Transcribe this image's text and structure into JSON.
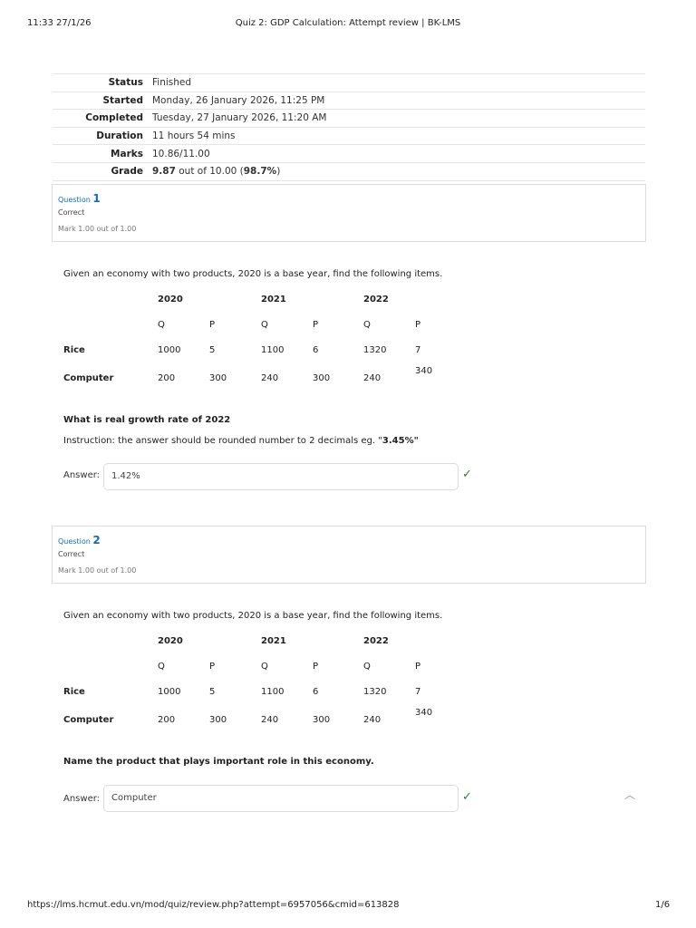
{
  "header": {
    "datetime": "11:33 27/1/26",
    "title": "Quiz 2: GDP Calculation: Attempt review | BK-LMS"
  },
  "summary": [
    {
      "k": "Status",
      "v": "Finished"
    },
    {
      "k": "Started",
      "v": "Monday, 26 January 2026, 11:25 PM"
    },
    {
      "k": "Completed",
      "v": "Tuesday, 27 January 2026, 11:20 AM"
    },
    {
      "k": "Duration",
      "v": "11 hours 54 mins"
    },
    {
      "k": "Marks",
      "v": "10.86/11.00"
    },
    {
      "k": "Grade",
      "v_bold": "9.87",
      "v_mid": " out of 10.00 (",
      "v_pct": "98.7%",
      "v_end": ")"
    }
  ],
  "table": {
    "years": [
      "2020",
      "2021",
      "2022"
    ],
    "q": "Q",
    "p": "P",
    "rows": [
      {
        "name": "Rice",
        "vals": [
          "1000",
          "5",
          "1100",
          "6",
          "1320",
          "7"
        ]
      },
      {
        "name": "Computer",
        "vals": [
          "200",
          "300",
          "240",
          "300",
          "240",
          "340"
        ]
      }
    ]
  },
  "questions": [
    {
      "label": "Question",
      "num": "1",
      "state": "Correct",
      "mark": "Mark 1.00 out of 1.00",
      "intro": "Given an economy with two products, 2020 is a base year, find the following items.",
      "prompt": "What is real growth rate of 2022",
      "instruction": "Instruction: the answer should be rounded number to 2 decimals eg. \"",
      "instruction_bold": "3.45%\"",
      "answer_label": "Answer:",
      "answer": "1.42%"
    },
    {
      "label": "Question",
      "num": "2",
      "state": "Correct",
      "mark": "Mark 1.00 out of 1.00",
      "intro": "Given an economy with two products, 2020 is a base year, find the following items.",
      "prompt": "Name the product that plays important role in this economy.",
      "answer_label": "Answer:",
      "answer": "Computer"
    }
  ],
  "footer": {
    "url": "https://lms.hcmut.edu.vn/mod/quiz/review.php?attempt=6957056&cmid=613828",
    "page": "1/6"
  }
}
